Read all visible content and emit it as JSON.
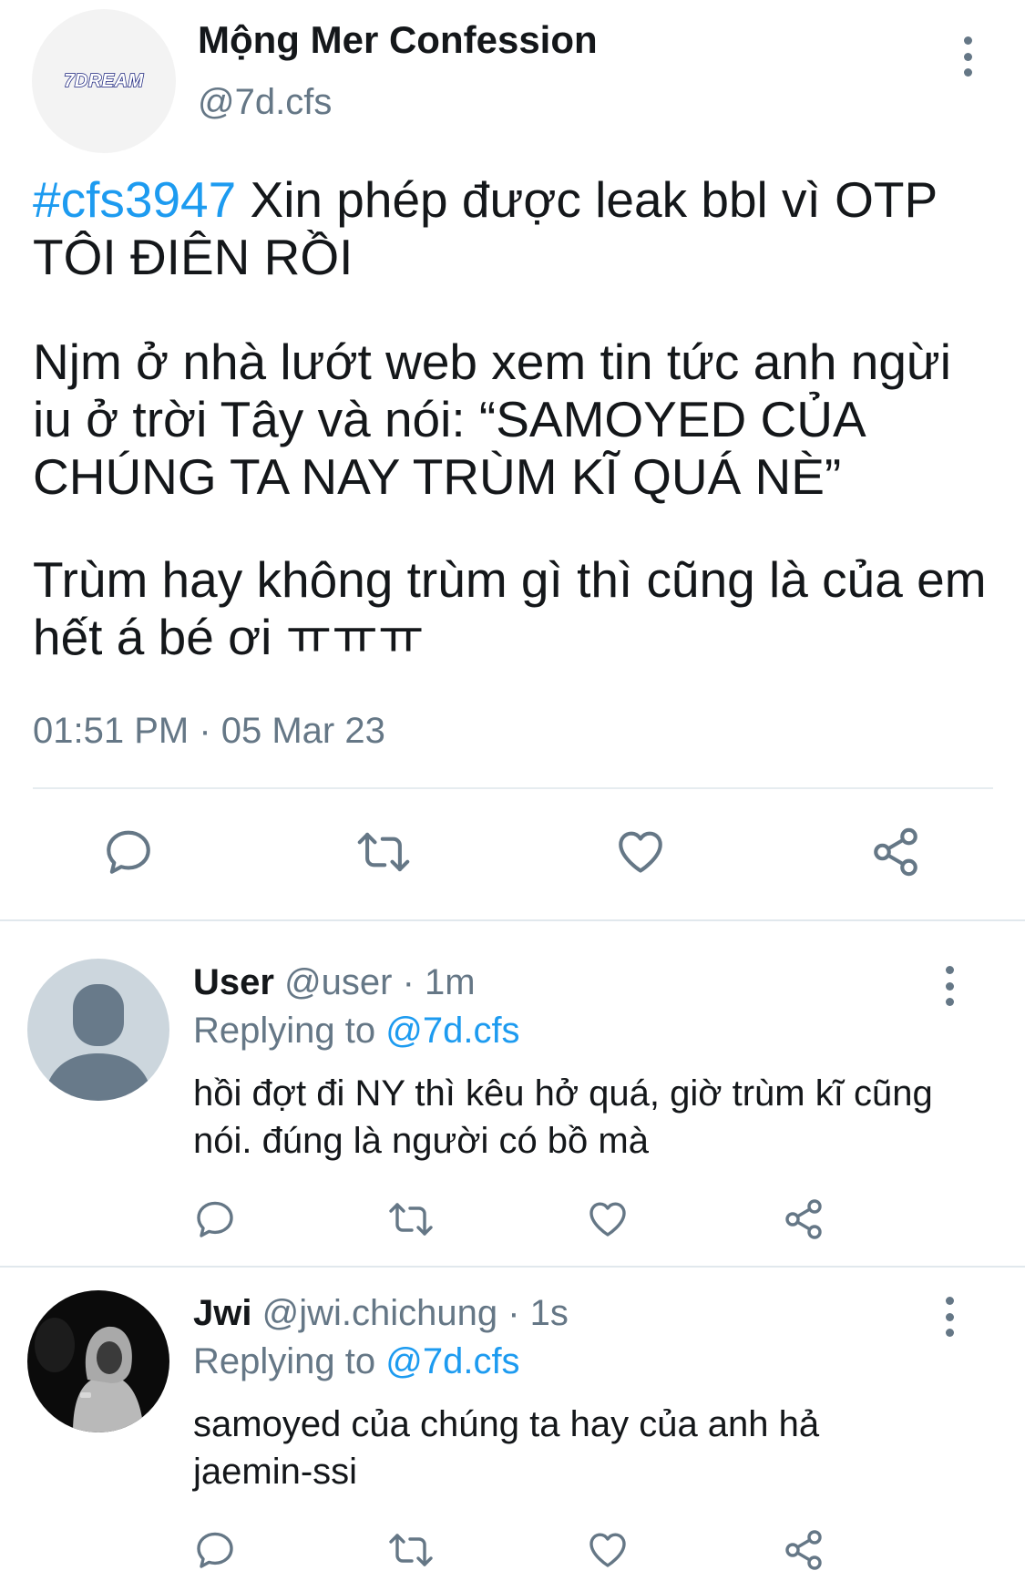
{
  "main_tweet": {
    "avatar_logo_text": "7DREAM",
    "display_name": "Mộng Mer Confession",
    "handle": "@7d.cfs",
    "hashtag": "#cfs3947",
    "paragraph1_rest": " Xin phép được leak bbl vì OTP TÔI ĐIÊN RỒI",
    "paragraph2": "Njm ở nhà lướt web xem tin tức anh ngừi iu ở trời Tây và nói: “SAMOYED CỦA CHÚNG TA NAY TRÙM KĨ QUÁ NÈ”",
    "paragraph3": "Trùm hay không trùm gì thì cũng là của em hết á bé ơi ㅠㅠㅠ",
    "timestamp": "01:51 PM · 05 Mar 23",
    "actions": [
      "reply-icon",
      "retweet-icon",
      "like-icon",
      "share-icon"
    ]
  },
  "replies": [
    {
      "display_name": "User",
      "handle": "@user",
      "separator": " · ",
      "time": "1m",
      "replying_label": "Replying to ",
      "replying_to": "@7d.cfs",
      "text": "hồi đợt đi NY thì kêu hở quá, giờ trùm kĩ cũng nói. đúng là người có bồ mà",
      "avatar": "default-user-avatar"
    },
    {
      "display_name": "Jwi",
      "handle": "@jwi.chichung",
      "separator": " · ",
      "time": "1s",
      "replying_label": "Replying to ",
      "replying_to": "@7d.cfs",
      "text": "samoyed của chúng ta hay của anh hả jaemin-ssi",
      "avatar": "photo-avatar"
    }
  ],
  "colors": {
    "accent": "#1d9bf0",
    "text_primary": "#14171a",
    "text_secondary": "#657786",
    "divider": "#e1e8ed",
    "icon": "#657786"
  }
}
